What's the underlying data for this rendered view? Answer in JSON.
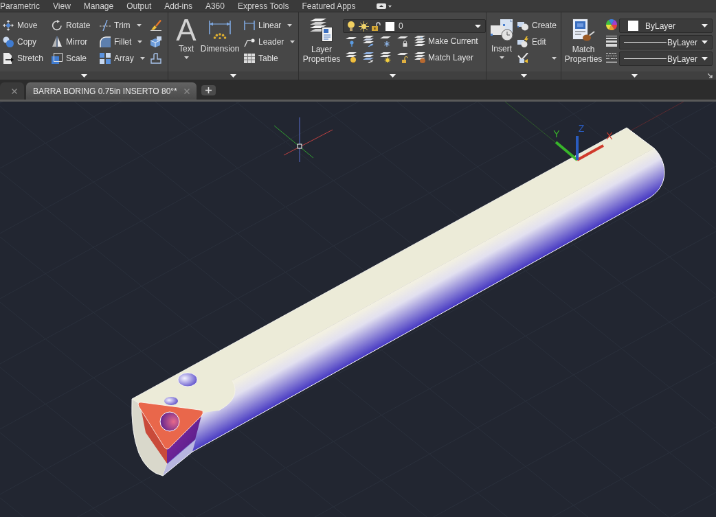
{
  "ribbon_tabs": [
    "Parametric",
    "View",
    "Manage",
    "Output",
    "Add-ins",
    "A360",
    "Express Tools",
    "Featured Apps"
  ],
  "ribbon": {
    "modify": {
      "columns": [
        [
          {
            "label": "Move",
            "dropdown": false
          },
          {
            "label": "Copy",
            "dropdown": false
          },
          {
            "label": "Stretch",
            "dropdown": false
          }
        ],
        [
          {
            "label": "Rotate",
            "dropdown": false
          },
          {
            "label": "Mirror",
            "dropdown": false
          },
          {
            "label": "Scale",
            "dropdown": false
          }
        ],
        [
          {
            "label": "Trim",
            "dropdown": true
          },
          {
            "label": "Fillet",
            "dropdown": true
          },
          {
            "label": "Array",
            "dropdown": true
          }
        ]
      ]
    },
    "annotation": {
      "large": [
        {
          "label": "Text",
          "glyph": "A",
          "dropdown": true
        },
        {
          "label": "Dimension",
          "dropdown": false
        }
      ],
      "small": [
        {
          "label": "Linear",
          "dropdown": true
        },
        {
          "label": "Leader",
          "dropdown": true
        },
        {
          "label": "Table",
          "dropdown": false
        }
      ]
    },
    "layers": {
      "large": {
        "label": "Layer Properties"
      },
      "current_layer": "0",
      "rows": [
        {
          "label": "Make Current"
        },
        {
          "label": "Match Layer"
        }
      ]
    },
    "block": {
      "large": {
        "label": "Insert",
        "dropdown": true
      },
      "small": [
        {
          "label": "Create",
          "dropdown": false
        },
        {
          "label": "Edit",
          "dropdown": false
        },
        {
          "dropdown": true
        }
      ]
    },
    "properties": {
      "large": {
        "label": "Match Properties"
      },
      "dropdowns": [
        {
          "kind": "color",
          "value": "ByLayer"
        },
        {
          "kind": "lineweight",
          "value": "ByLayer"
        },
        {
          "kind": "linetype",
          "value": "ByLayer"
        }
      ]
    }
  },
  "document_tabs": [
    {
      "selected": false
    },
    {
      "label": "BARRA BORING 0.75in INSERTO 80°*",
      "selected": true
    }
  ],
  "viewport": {
    "ucs_axes": [
      {
        "label": "X",
        "color": "#d03a2c"
      },
      {
        "label": "Y",
        "color": "#38b52a"
      },
      {
        "label": "Z",
        "color": "#2a5cc0"
      }
    ]
  }
}
